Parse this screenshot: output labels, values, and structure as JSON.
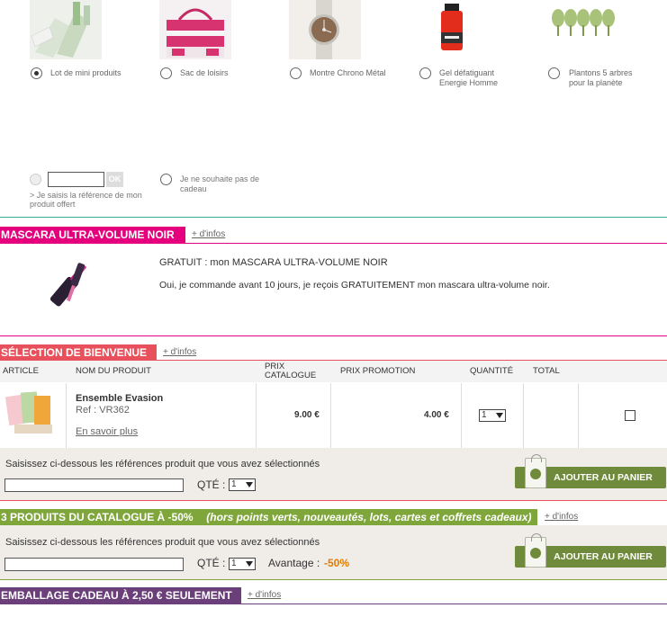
{
  "gifts": {
    "options": [
      {
        "label": "Lot de mini produits",
        "checked": true
      },
      {
        "label": "Sac de loisirs",
        "checked": false
      },
      {
        "label": "Montre Chrono Métal",
        "checked": false
      },
      {
        "label": "Gel défatiguant\nEnergie Homme",
        "checked": false
      },
      {
        "label": "Plantons 5 arbres\npour la planète",
        "checked": false
      }
    ],
    "ok_label": "OK",
    "reference_note": "> Je saisis la référence de mon produit offert",
    "no_gift_label": "Je ne souhaite pas de cadeau"
  },
  "mascara": {
    "title": "MASCARA ULTRA-VOLUME NOIR",
    "infos": "+ d'infos",
    "line1": "GRATUIT : mon MASCARA ULTRA-VOLUME NOIR",
    "line2": "Oui, je commande avant 10 jours, je reçois GRATUITEMENT mon mascara ultra-volume noir."
  },
  "bienvenue": {
    "title": "SÉLECTION DE BIENVENUE",
    "infos": "+ d'infos",
    "headers": {
      "article": "ARTICLE",
      "nom": "NOM DU PRODUIT",
      "prix_catalogue": "PRIX\nCATALOGUE",
      "prix_promo": "PRIX PROMOTION",
      "quantite": "QUANTITÉ",
      "total": "TOTAL"
    },
    "row": {
      "name": "Ensemble Evasion",
      "ref": "Ref : VR362",
      "more": "En savoir plus",
      "price_catalogue": "9.00 €",
      "price_promo": "4.00 €",
      "quantity": "1"
    },
    "entry_label": "Saisissez ci-dessous les références produit que vous avez sélectionnés",
    "qty_label": "QTÉ :",
    "qty_value": "1",
    "cart_button": "AJOUTER AU PANIER"
  },
  "catalogue": {
    "title": "3 PRODUITS DU CATALOGUE À -50%",
    "subtitle": "(hors points verts, nouveautés, lots, cartes et coffrets cadeaux)",
    "infos": "+ d'infos",
    "entry_label": "Saisissez ci-dessous les références produit que vous avez sélectionnés",
    "qty_label": "QTÉ :",
    "qty_value": "1",
    "advantage_label": "Avantage :",
    "advantage_value": "-50%",
    "cart_button": "AJOUTER AU PANIER"
  },
  "emballage": {
    "title": "EMBALLAGE CADEAU À 2,50 € SEULEMENT",
    "infos": "+ d'infos"
  },
  "colors": {
    "pink": "#e5007e",
    "salmon": "#e8505b",
    "green": "#7fa63a",
    "purple": "#6a3f7a",
    "teal": "#3aa99f",
    "button_green": "#6f8a3a",
    "orange": "#e07b00"
  }
}
